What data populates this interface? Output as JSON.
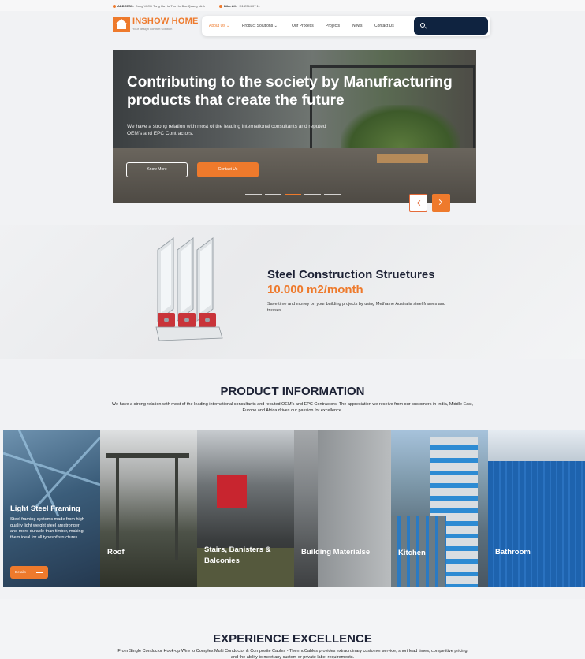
{
  "topbar": {
    "address_label": "ADDRESS:",
    "address_value": "Dong Vi Chi Tong Ha Ha Tho Ha Bac Quang Ninh",
    "email_label": "Biko All:",
    "email_value": "+91 2344 07 11"
  },
  "brand": {
    "name": "INSHOW HOME",
    "tagline": "Your design comfort solution"
  },
  "nav": {
    "items": [
      {
        "label": "About Us ⌄",
        "active": true
      },
      {
        "label": "Product Solutions ⌄",
        "active": false
      },
      {
        "label": "Our Process",
        "active": false
      },
      {
        "label": "Projects",
        "active": false
      },
      {
        "label": "News",
        "active": false
      },
      {
        "label": "Contact Us",
        "active": false
      }
    ],
    "search_icon": "search-icon"
  },
  "hero": {
    "title": "Contributing to the society by Manufracturing products that create the future",
    "description": "We have a strong relation with most of the leading international consultants and reputed OEM's and EPC Contractors.",
    "primary_button": "Know More",
    "secondary_button": "Contact Us",
    "slide_count": 5,
    "active_slide": 3
  },
  "feature": {
    "title": "Steel Construction Struetures",
    "metric": "10.000 m2/month",
    "description": "Save time and money on your building projects by using Metframe Australia steel frames and trusses."
  },
  "products": {
    "heading": "PRODUCT INFORMATION",
    "description": "We have a strong relation with most of the leading international consultants and reputed OEM's and EPC Contractors. The appreciation we receive from our customers in India, Middle East, Europe and Africa drives our passion for excellence.",
    "cards": [
      {
        "label": "Light Steel Framing",
        "description": "Steel framing systems made from high-quality light weight steel arestronger and more durable than timber, making them ideal for all typesof structures.",
        "button": "Details"
      },
      {
        "label": "Roof"
      },
      {
        "label": "Stairs, Banisters & Balconies"
      },
      {
        "label": "Building Materialse"
      },
      {
        "label": "Kitchen"
      },
      {
        "label": "Bathroom"
      }
    ]
  },
  "experience": {
    "heading": "EXPERIENCE EXCELLENCE",
    "description": "From Single Conductor Hook-up Wire to Complex Multi Conductor & Composite Cables - ThermoCables provides extraordinary customer service, short lead times, competitive pricing and the ability to meet any custom or private label requirements."
  },
  "colors": {
    "accent": "#ee7a2c",
    "navy": "#0f2340",
    "heading": "#1d2235"
  }
}
